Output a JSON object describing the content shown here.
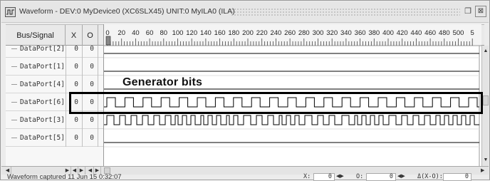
{
  "window": {
    "title": "Waveform - DEV:0 MyDevice0 (XC6SLX45) UNIT:0 MyILA0 (ILA)",
    "restore_glyph": "❐",
    "close_glyph": "⊠"
  },
  "header": {
    "bus_signal": "Bus/Signal",
    "x": "X",
    "o": "O"
  },
  "timeline": {
    "ticks": [
      "0",
      "20",
      "40",
      "60",
      "80",
      "100",
      "120",
      "140",
      "160",
      "180",
      "200",
      "220",
      "240",
      "260",
      "280",
      "300",
      "320",
      "340",
      "360",
      "380",
      "400",
      "420",
      "440",
      "460",
      "480",
      "500",
      "5"
    ]
  },
  "signals": [
    {
      "name": "DataPort[2]",
      "x": "0",
      "o": "0"
    },
    {
      "name": "DataPort[1]",
      "x": "0",
      "o": "0"
    },
    {
      "name": "DataPort[4]",
      "x": "0",
      "o": "0"
    },
    {
      "name": "DataPort[6]",
      "x": "0",
      "o": "0"
    },
    {
      "name": "DataPort[3]",
      "x": "0",
      "o": "0"
    },
    {
      "name": "DataPort[5]",
      "x": "0",
      "o": "0"
    }
  ],
  "annotation": {
    "label": "Generator bits"
  },
  "status": {
    "text": "Waveform captured 11 Jun 15 0:32:07",
    "x_label": "X:",
    "x_value": "0",
    "o_label": "O:",
    "o_value": "0",
    "delta_label": "Δ(X-O):",
    "delta_value": "0"
  },
  "icons": {
    "app": "waveform-app-icon",
    "left_arrow": "◀",
    "right_arrow": "▶",
    "up_arrow": "▲",
    "down_arrow": "▼"
  }
}
